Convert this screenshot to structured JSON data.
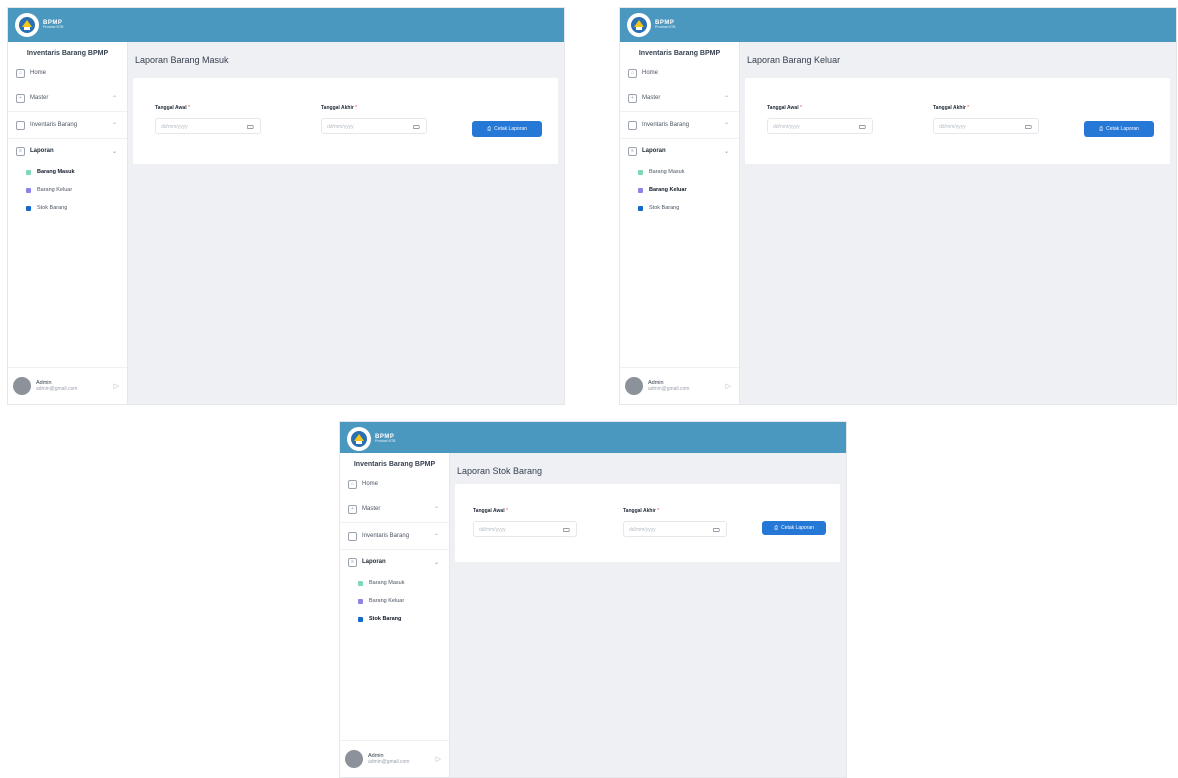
{
  "colors": {
    "topbar": "#4a97bf",
    "button": "#2678d6",
    "dot_masuk": "#7dd9b8",
    "dot_keluar": "#8d83e6",
    "dot_stok": "#1769c9"
  },
  "logo": {
    "title": "BPMP",
    "subtitle": "Provinsi NTB"
  },
  "sidebar": {
    "app_title": "Inventaris Barang BPMP",
    "home": "Home",
    "master": "Master",
    "inventaris": "Inventaris Barang",
    "laporan": "Laporan",
    "sub_items": [
      "Barang Masuk",
      "Barang Keluar",
      "Stok Barang"
    ]
  },
  "user": {
    "name": "Admin",
    "email": "admin@gmail.com"
  },
  "form": {
    "start_label": "Tanggal Awal",
    "end_label": "Tanggal Akhir",
    "required_mark": "*",
    "date_placeholder": "dd/mm/yyyy",
    "print_button": "Cetak Laporan"
  },
  "screens": [
    {
      "page_title": "Laporan Barang Masuk",
      "active_sub": 0
    },
    {
      "page_title": "Laporan Barang Keluar",
      "active_sub": 1
    },
    {
      "page_title": "Laporan Stok Barang",
      "active_sub": 2
    }
  ]
}
